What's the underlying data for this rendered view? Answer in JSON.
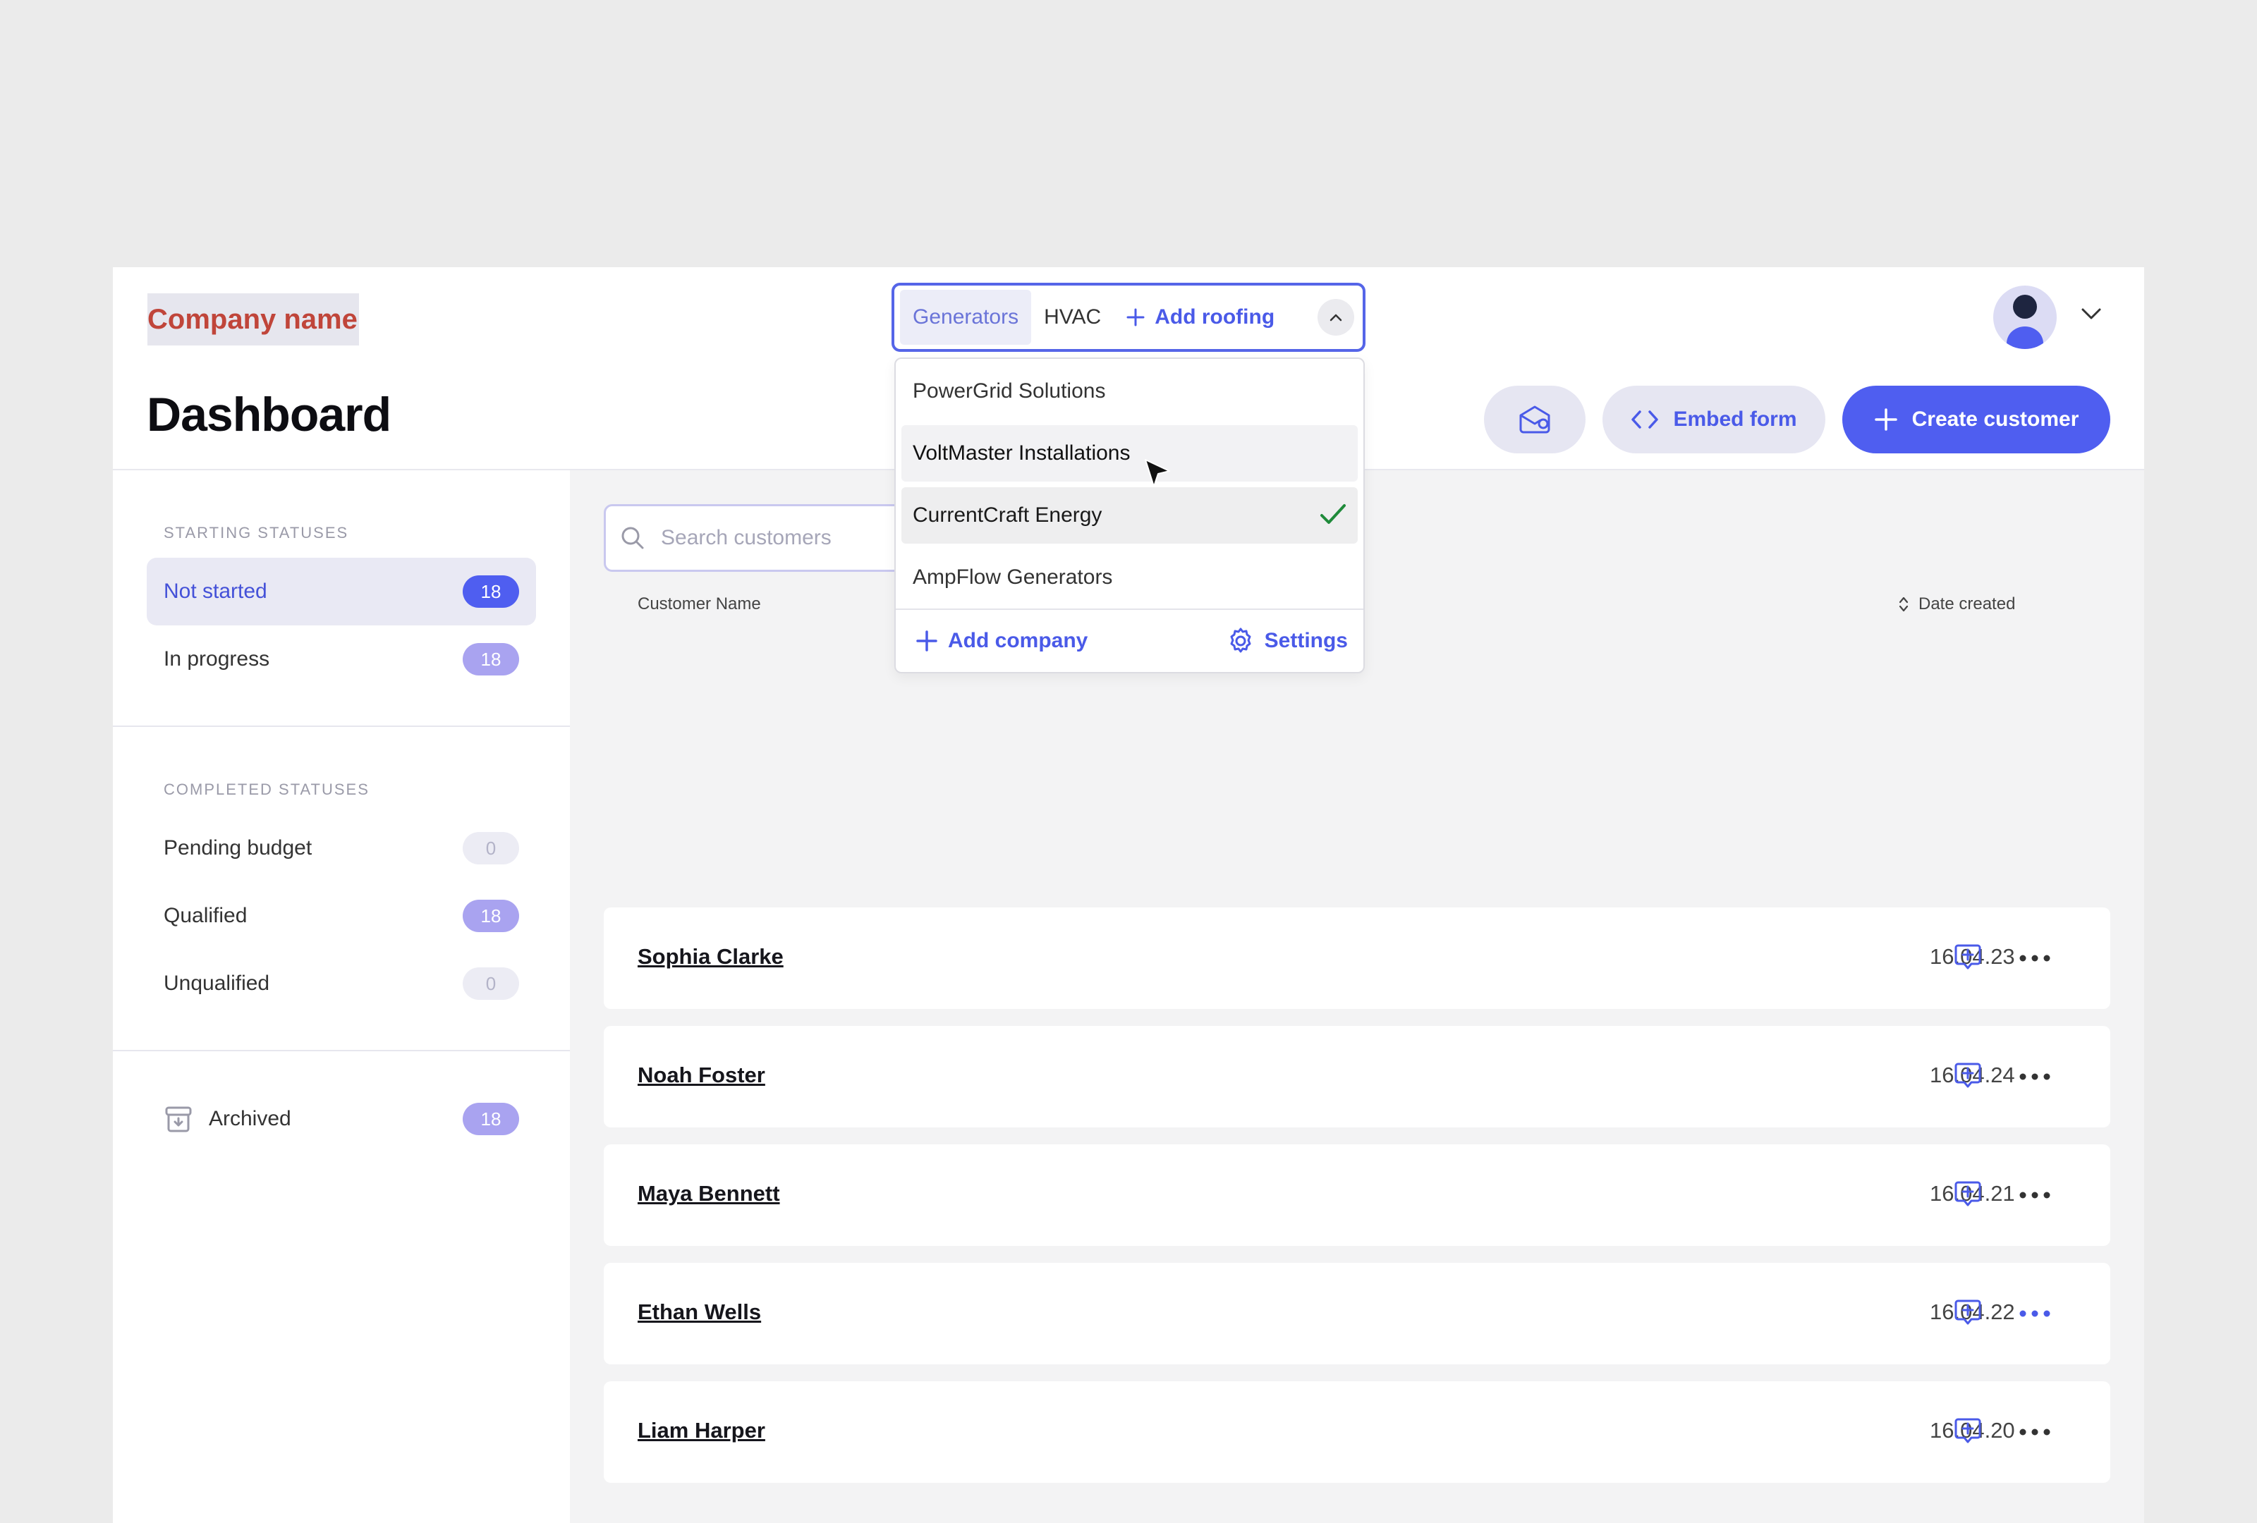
{
  "header": {
    "company_name": "Company name",
    "page_title": "Dashboard",
    "categories": [
      {
        "label": "Generators",
        "active": true
      },
      {
        "label": "HVAC",
        "active": false
      }
    ],
    "add_category_label": "Add roofing",
    "embed_label": "Embed form",
    "create_label": "Create customer"
  },
  "dropdown": {
    "items": [
      {
        "label": "PowerGrid Solutions",
        "state": "normal"
      },
      {
        "label": "VoltMaster Installations",
        "state": "hover"
      },
      {
        "label": "CurrentCraft Energy",
        "state": "selected"
      },
      {
        "label": "AmpFlow Generators",
        "state": "normal"
      }
    ],
    "add_label": "Add company",
    "settings_label": "Settings"
  },
  "sidebar": {
    "starting_heading": "STARTING STATUSES",
    "starting": [
      {
        "label": "Not started",
        "count": "18"
      },
      {
        "label": "In progress",
        "count": "18"
      }
    ],
    "completed_heading": "COMPLETED STATUSES",
    "completed": [
      {
        "label": "Pending budget",
        "count": "0"
      },
      {
        "label": "Qualified",
        "count": "18"
      },
      {
        "label": "Unqualified",
        "count": "0"
      }
    ],
    "archived": {
      "label": "Archived",
      "count": "18"
    }
  },
  "table": {
    "search_placeholder": "Search customers",
    "col_name": "Customer Name",
    "col_date": "Date created",
    "rows": [
      {
        "name": "Sophia Clarke",
        "date": "16.04.23"
      },
      {
        "name": "Noah Foster",
        "date": "16.04.24"
      },
      {
        "name": "Maya Bennett",
        "date": "16.04.21"
      },
      {
        "name": "Ethan Wells",
        "date": "16.04.22"
      },
      {
        "name": "Liam Harper",
        "date": "16.04.20"
      }
    ]
  },
  "colors": {
    "accent": "#4f5ef0",
    "company_name": "#c0453a",
    "check": "#1f8a3a"
  }
}
